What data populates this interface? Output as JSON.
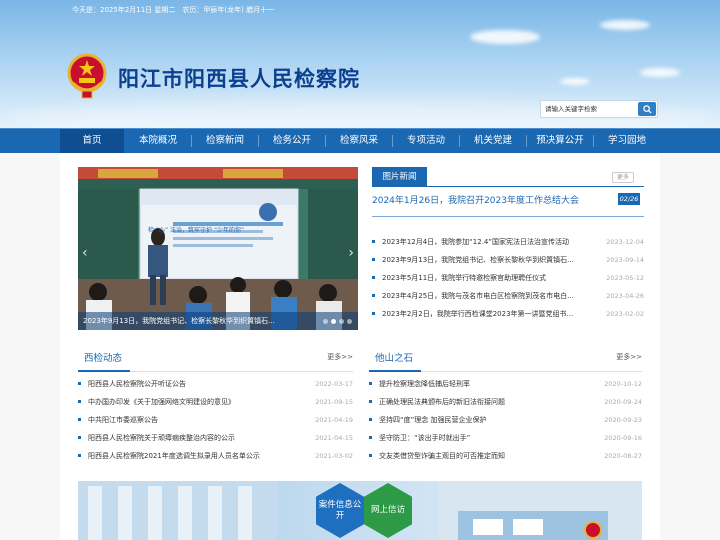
{
  "header": {
    "date_line": "今天是：2025年2月11日 星期二　农历：甲辰年(龙年) 腊月十一",
    "site_title": "阳江市阳西县人民检察院",
    "search_placeholder": "请输入关键字检索"
  },
  "nav": {
    "items": [
      {
        "label": "首页"
      },
      {
        "label": "本院概况"
      },
      {
        "label": "检察新闻"
      },
      {
        "label": "检务公开"
      },
      {
        "label": "检察风采"
      },
      {
        "label": "专项活动"
      },
      {
        "label": "机关党建"
      },
      {
        "label": "预决算公开"
      },
      {
        "label": "学习园地"
      }
    ]
  },
  "slider": {
    "caption": "2023年9月13日，我院党组书记、检察长黎秋华到织篢镇石...",
    "dot_count": 4,
    "active_dot": 1,
    "screen_text": "检 “心” 法治，筑牢守护 “少年的你”"
  },
  "pic_news": {
    "tab_label": "图片新闻",
    "more_label": "更多",
    "headline": "2024年1月26日，我院召开2023年度工作总结大会",
    "page": "02/26",
    "items": [
      {
        "title": "2023年12月4日，我院参加“12.4”国家宪法日法治宣传活动",
        "date": "2023-12-04"
      },
      {
        "title": "2023年9月13日，我院党组书记、检察长黎秋华到织篢镇石...",
        "date": "2023-09-14"
      },
      {
        "title": "2023年5月11日，我院举行特邀检察官助理聘任仪式",
        "date": "2023-05-12"
      },
      {
        "title": "2023年4月25日，我院与茂名市电白区检察院到茂名市电白...",
        "date": "2023-04-26"
      },
      {
        "title": "2023年2月2日，我院举行西检课堂2023年第一讲暨党组书...",
        "date": "2023-02-02"
      }
    ]
  },
  "xijian": {
    "title": "西检动态",
    "more_label": "更多>>",
    "items": [
      {
        "title": "阳西县人民检察院公开听证公告",
        "date": "2022-03-17"
      },
      {
        "title": "中办国办印发《关于加强网络文明建设的意见》",
        "date": "2021-09-15"
      },
      {
        "title": "中共阳江市委巡察公告",
        "date": "2021-04-19"
      },
      {
        "title": "阳西县人民检察院关于顽瘴痼疾整治内容的公示",
        "date": "2021-04-15"
      },
      {
        "title": "阳西县人民检察院2021年度选调生拟录用人员名单公示",
        "date": "2021-03-02"
      }
    ]
  },
  "tashan": {
    "title": "他山之石",
    "more_label": "更多>>",
    "items": [
      {
        "title": "提升检察理念降低捕后轻刑率",
        "date": "2020-10-12"
      },
      {
        "title": "正确处理民法典颁布后的新旧法衔接问题",
        "date": "2020-09-24"
      },
      {
        "title": "坚持四“度”理念 加强民营企业保护",
        "date": "2020-09-23"
      },
      {
        "title": "坚守防卫：“该出手时就出手”",
        "date": "2020-09-16"
      },
      {
        "title": "交友类借贷型诈骗主观目的可否推定而知",
        "date": "2020-08-27"
      }
    ]
  },
  "banner": {
    "hex1": "案件信息公开",
    "hex2": "网上信访",
    "hex1_color": "#1f6fc0",
    "hex2_color": "#2c9a46"
  },
  "colors": {
    "primary": "#1a67b2",
    "nav_active": "#0f4f91",
    "title": "#0c3f8e"
  }
}
